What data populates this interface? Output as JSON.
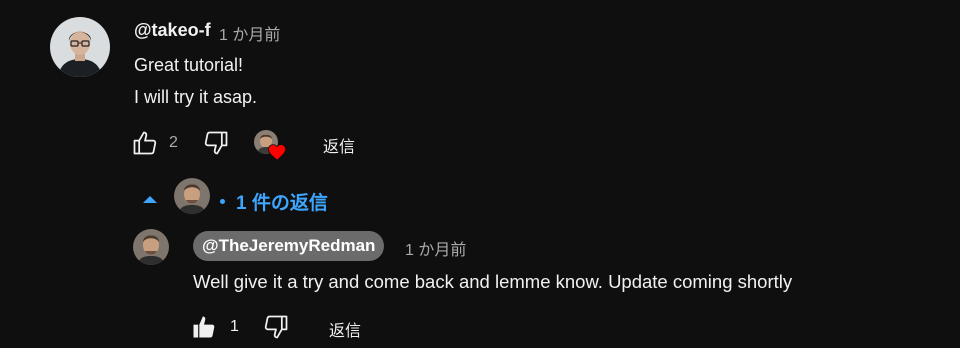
{
  "comment": {
    "author": "@takeo-f",
    "time": "1 か月前",
    "lines": [
      "Great tutorial!",
      "I will try it asap."
    ],
    "like_count": "2",
    "reply_label": "返信",
    "creator_heart": true
  },
  "replies_toggle": {
    "count_label": "1 件の返信",
    "expanded": true
  },
  "reply": {
    "author": "@TheJeremyRedman",
    "time": "1 か月前",
    "text": "Well give it a try and come back and lemme know. Update coming shortly",
    "like_count": "1",
    "liked": true,
    "reply_label": "返信"
  },
  "colors": {
    "background": "#0f0f0f",
    "link_blue": "#3ea6ff",
    "heart_red": "#ff0000",
    "secondary_text": "#aaaaaa"
  },
  "icons": {
    "like": "thumbs-up-icon",
    "dislike": "thumbs-down-icon",
    "heart": "heart-icon",
    "caret": "caret-up-icon"
  }
}
